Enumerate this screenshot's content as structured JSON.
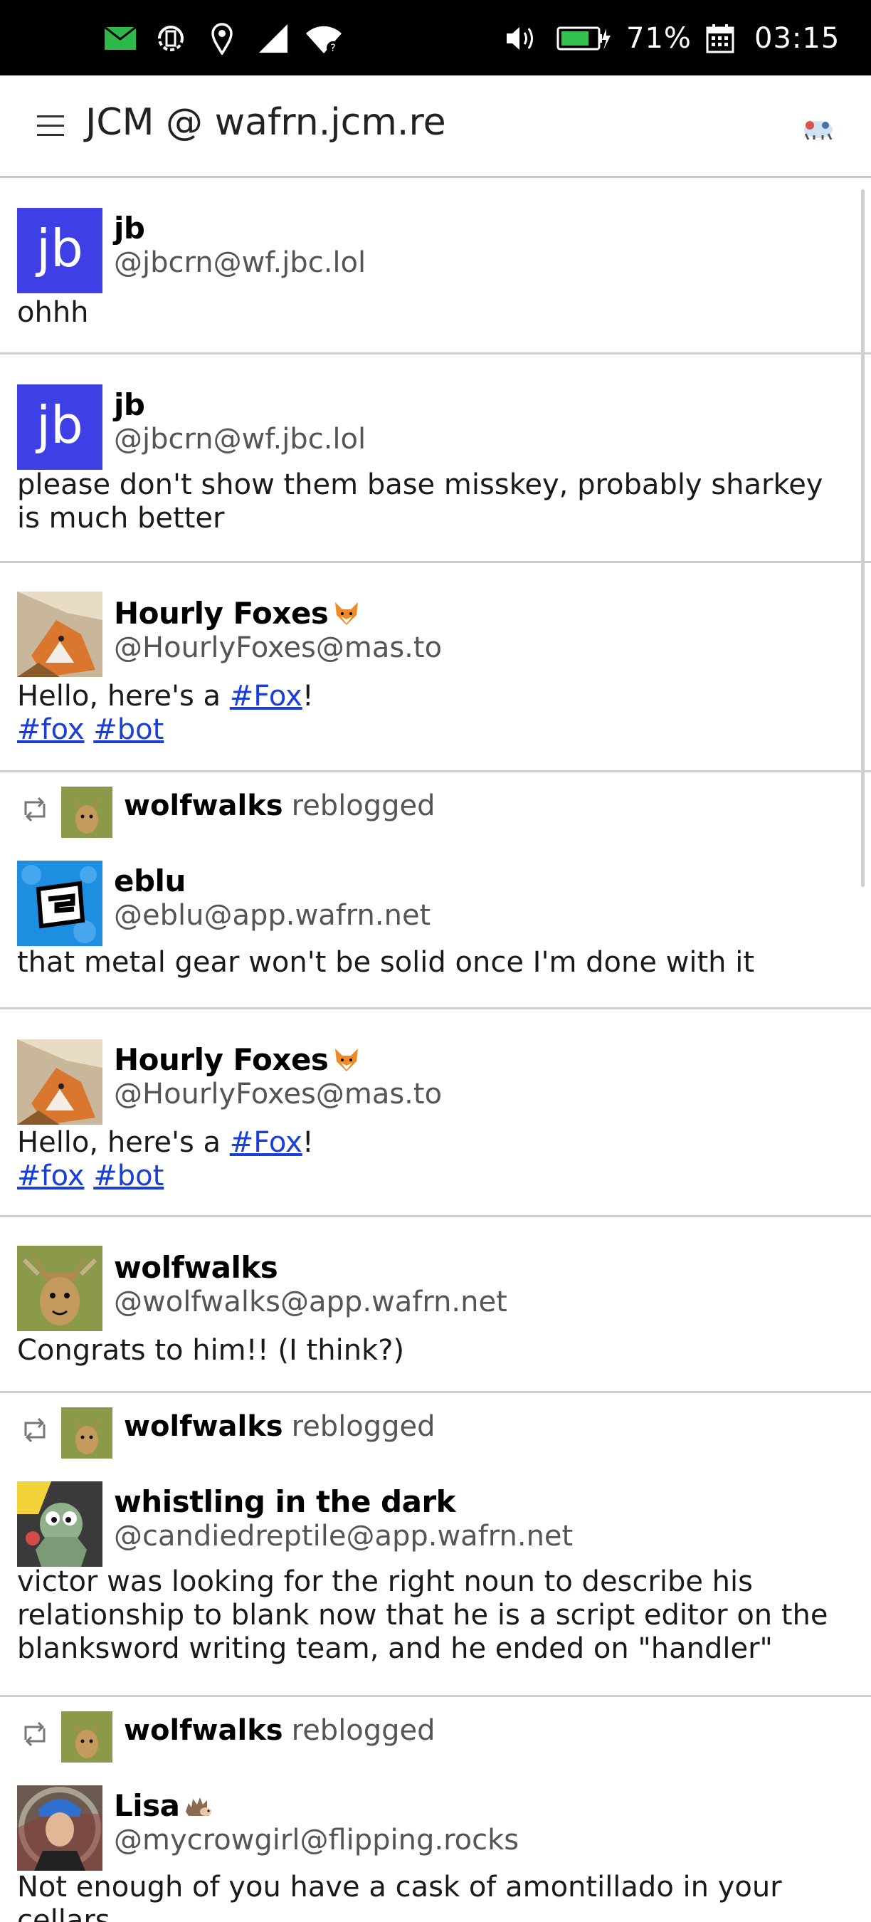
{
  "status_bar": {
    "battery": "71%",
    "time": "03:15",
    "icons": [
      "mail-icon",
      "rotation-icon",
      "location-icon",
      "signal-icon",
      "wifi-icon",
      "volume-icon",
      "battery-icon",
      "calendar-icon"
    ]
  },
  "header": {
    "title": "JCM @ wafrn.jcm.re",
    "menu_icon": "hamburger-menu-icon",
    "account_icon": "account-avatar-icon"
  },
  "reblog_label": "reblogged",
  "posts": [
    {
      "name": "jb",
      "handle": "@jbcrn@wf.jbc.lol",
      "avatar_text": "jb",
      "text": "ohhh"
    },
    {
      "name": "jb",
      "handle": "@jbcrn@wf.jbc.lol",
      "avatar_text": "jb",
      "text": "please don't show them base misskey, probably sharkey is much better"
    },
    {
      "name": "Hourly Foxes",
      "handle": "@HourlyFoxes@mas.to",
      "emoji": "fox-emoji",
      "text_before": "Hello, here's a ",
      "link": "#Fox",
      "text_after": "!",
      "tags": [
        "#fox",
        "#bot"
      ]
    },
    {
      "reblogged_by": "wolfwalks",
      "name": "eblu",
      "handle": "@eblu@app.wafrn.net",
      "text": "that metal gear won't be solid once I'm done with it"
    },
    {
      "name": "Hourly Foxes",
      "handle": "@HourlyFoxes@mas.to",
      "emoji": "fox-emoji",
      "text_before": "Hello, here's a ",
      "link": "#Fox",
      "text_after": "!",
      "tags": [
        "#fox",
        "#bot"
      ]
    },
    {
      "name": "wolfwalks",
      "handle": "@wolfwalks@app.wafrn.net",
      "text": "Congrats to him!! (I think?)"
    },
    {
      "reblogged_by": "wolfwalks",
      "name": "whistling in the dark",
      "handle": "@candiedreptile@app.wafrn.net",
      "text": "victor was looking for the right noun to describe his relationship to blank now that he is a script editor on the blanksword writing team, and he ended on \"handler\""
    },
    {
      "reblogged_by": "wolfwalks",
      "name": "Lisa",
      "emoji": "hedgehog-emoji",
      "handle": "@mycrowgirl@flipping.rocks",
      "text": "Not enough of you have a cask of amontillado in your cellars,"
    }
  ],
  "colors": {
    "jb_avatar": "#3f3fe6",
    "link": "#1a3fd6",
    "divider": "#cfcfcf",
    "status_bar": "#000000"
  }
}
